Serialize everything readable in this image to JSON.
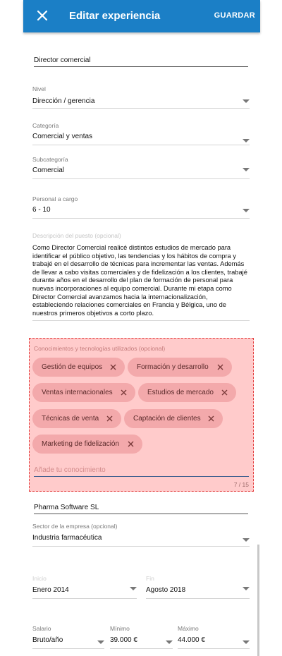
{
  "header": {
    "title": "Editar experiencia",
    "save_label": "GUARDAR",
    "background": "#1b7fc6"
  },
  "form": {
    "position_title": "Director comercial",
    "level": {
      "label": "Nivel",
      "value": "Dirección / gerencia"
    },
    "category": {
      "label": "Categoría",
      "value": "Comercial y ventas"
    },
    "subcategory": {
      "label": "Subcategoría",
      "value": "Comercial"
    },
    "staff": {
      "label": "Personal a cargo",
      "value": "6 - 10"
    },
    "description": {
      "label": "Descripción del puesto (opcional)",
      "value": "Como Director Comercial realicé distintos estudios de mercado para identificar el público objetivo, las tendencias y los hábitos de compra y trabajé en el desarrollo de técnicas para incrementar las ventas. Además de llevar a cabo visitas comerciales y de fidelización a los clientes, trabajé durante años en el desarrollo del plan de formación de personal para nuevas incorporaciones al equipo comercial. Durante mi etapa como Director Comercial avanzamos hacia la internacionalización, estableciendo relaciones comerciales en Francia y Bélgica, uno de nuestros primeros objetivos a corto plazo."
    },
    "skills": {
      "label": "Conocimientos y tecnologías utilizados (opcional)",
      "chips": [
        "Gestión de equipos",
        "Formación y desarrollo",
        "Ventas internacionales",
        "Estudios de mercado",
        "Técnicas de venta",
        "Captación de clientes",
        "Marketing de fidelización"
      ],
      "placeholder": "Añade tu conocimiento",
      "counter": "7 / 15"
    },
    "company": "Pharma Software SL",
    "sector": {
      "label": "Sector de la empresa (opcional)",
      "value": "Industria farmacéutica"
    },
    "start": {
      "label": "Inicio",
      "value": "Enero 2014"
    },
    "end": {
      "label": "Fin",
      "value": "Agosto 2018"
    },
    "salary": {
      "label": "Salario",
      "value": "Bruto/año"
    },
    "min": {
      "label": "Mínimo",
      "value": "39.000 €"
    },
    "max": {
      "label": "Máximo",
      "value": "44.000 €"
    }
  }
}
